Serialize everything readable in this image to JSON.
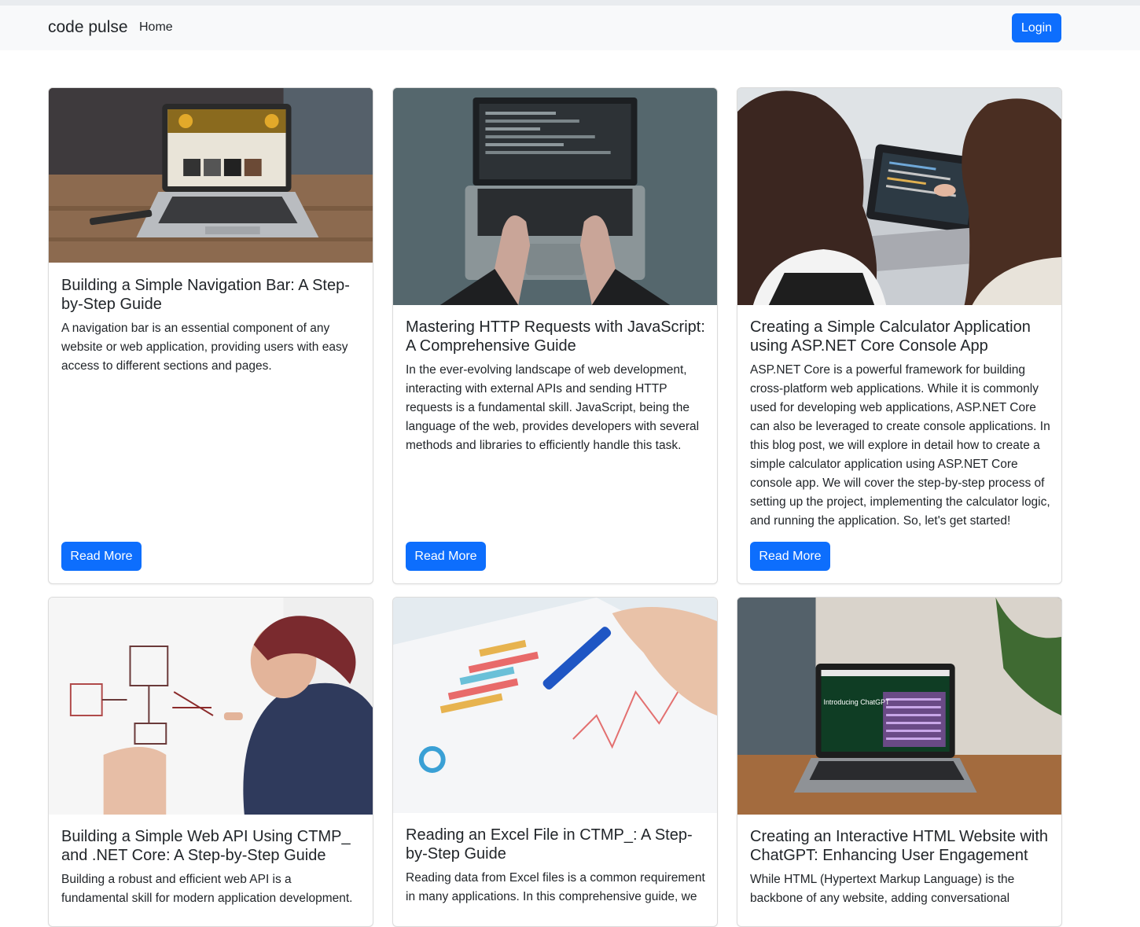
{
  "navbar": {
    "brand": "code pulse",
    "home_label": "Home",
    "login_label": "Login",
    "accent_color": "#0d6efd"
  },
  "posts": [
    {
      "title": "Building a Simple Navigation Bar: A Step-by-Step Guide",
      "summary": "A navigation bar is an essential component of any website or web application, providing users with easy access to different sections and pages.",
      "button_label": "Read More"
    },
    {
      "title": "Mastering HTTP Requests with JavaScript: A Comprehensive Guide",
      "summary": "In the ever-evolving landscape of web development, interacting with external APIs and sending HTTP requests is a fundamental skill. JavaScript, being the language of the web, provides developers with several methods and libraries to efficiently handle this task.",
      "button_label": "Read More"
    },
    {
      "title": "Creating a Simple Calculator Application using ASP.NET Core Console App",
      "summary": "ASP.NET Core is a powerful framework for building cross-platform web applications. While it is commonly used for developing web applications, ASP.NET Core can also be leveraged to create console applications. In this blog post, we will explore in detail how to create a simple calculator application using ASP.NET Core console app. We will cover the step-by-step process of setting up the project, implementing the calculator logic, and running the application. So, let's get started!",
      "button_label": "Read More"
    },
    {
      "title": "Building a Simple Web API Using CTMP_ and .NET Core: A Step-by-Step Guide",
      "summary": "Building a robust and efficient web API is a fundamental skill for modern application development."
    },
    {
      "title": "Reading an Excel File in CTMP_: A Step-by-Step Guide",
      "summary": "Reading data from Excel files is a common requirement in many applications. In this comprehensive guide, we"
    },
    {
      "title": "Creating an Interactive HTML Website with ChatGPT: Enhancing User Engagement",
      "summary": "While HTML (Hypertext Markup Language) is the backbone of any website, adding conversational"
    }
  ],
  "images": [
    {
      "icon": "laptop-on-desk-photo"
    },
    {
      "icon": "hands-typing-laptop-photo"
    },
    {
      "icon": "women-at-laptop-photo"
    },
    {
      "icon": "man-drawing-whiteboard-photo"
    },
    {
      "icon": "pen-on-chart-paper-photo"
    },
    {
      "icon": "laptop-chatgpt-screen-photo",
      "screen_text": "Introducing ChatGPT"
    }
  ]
}
